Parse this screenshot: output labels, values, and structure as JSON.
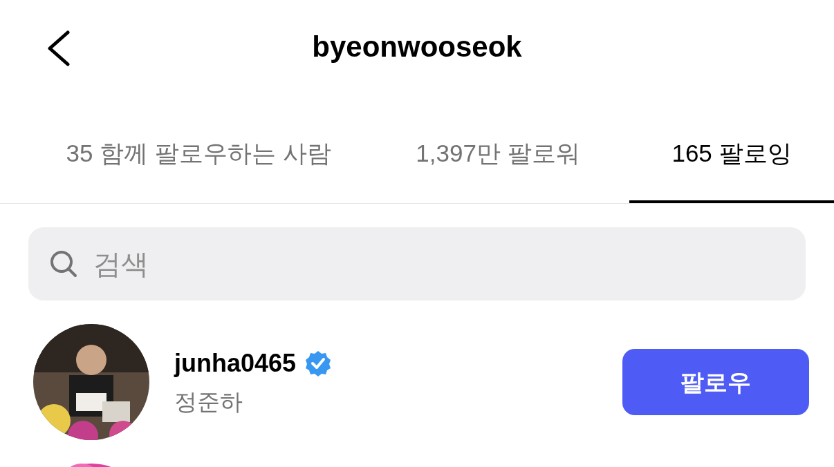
{
  "header": {
    "title": "byeonwooseok"
  },
  "tabs": [
    {
      "label": "35 함께 팔로우하는 사람",
      "selected": false
    },
    {
      "label": "1,397만 팔로워",
      "selected": false
    },
    {
      "label": "165 팔로잉",
      "selected": true
    }
  ],
  "search": {
    "placeholder": "검색"
  },
  "rows": [
    {
      "kind": "account",
      "username": "junha0465",
      "verified": true,
      "name": "정준하",
      "button": "팔로우"
    },
    {
      "kind": "partial"
    }
  ]
}
